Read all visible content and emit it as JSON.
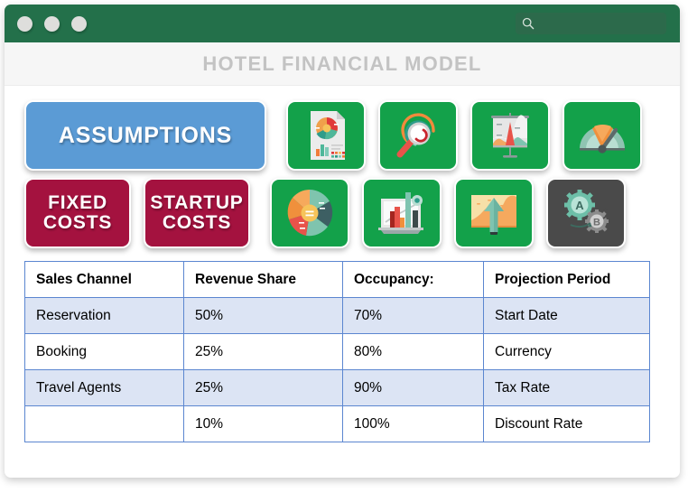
{
  "window": {
    "dots": [
      "window-dot-1",
      "window-dot-2",
      "window-dot-3"
    ],
    "search": {
      "icon": "search-icon",
      "value": "",
      "placeholder": ""
    }
  },
  "header": {
    "title": "HOTEL FINANCIAL MODEL"
  },
  "buttons": {
    "assumptions": {
      "label": "ASSUMPTIONS",
      "color": "#5b9bd5"
    },
    "fixed_costs": {
      "line1": "FIXED",
      "line2": "COSTS",
      "color": "#a4123f"
    },
    "startup_costs": {
      "line1": "STARTUP",
      "line2": "COSTS",
      "color": "#a4123f"
    }
  },
  "tiles": {
    "row1": [
      {
        "name": "report-document-chart-icon",
        "bg": "#13a14a"
      },
      {
        "name": "magnifier-analysis-icon",
        "bg": "#13a14a"
      },
      {
        "name": "presentation-chart-icon",
        "bg": "#13a14a"
      },
      {
        "name": "gauge-meter-icon",
        "bg": "#13a14a"
      }
    ],
    "row2": [
      {
        "name": "donut-pie-chart-icon",
        "bg": "#13a14a"
      },
      {
        "name": "bar-chart-trend-icon",
        "bg": "#13a14a"
      },
      {
        "name": "area-chart-growth-icon",
        "bg": "#13a14a"
      },
      {
        "name": "ab-testing-gears-icon",
        "bg": "#4a4a4a"
      }
    ]
  },
  "table": {
    "headers": [
      "Sales Channel",
      "Revenue Share",
      "Occupancy:",
      "Projection Period"
    ],
    "rows": [
      [
        "Reservation",
        "50%",
        "70%",
        "Start Date"
      ],
      [
        "Booking",
        "25%",
        "80%",
        "Currency"
      ],
      [
        "Travel Agents",
        "25%",
        "90%",
        "Tax Rate"
      ],
      [
        "",
        "10%",
        "100%",
        "Discount Rate"
      ]
    ],
    "border_color": "#5b86d0",
    "alt_row_color": "#dce4f4"
  }
}
